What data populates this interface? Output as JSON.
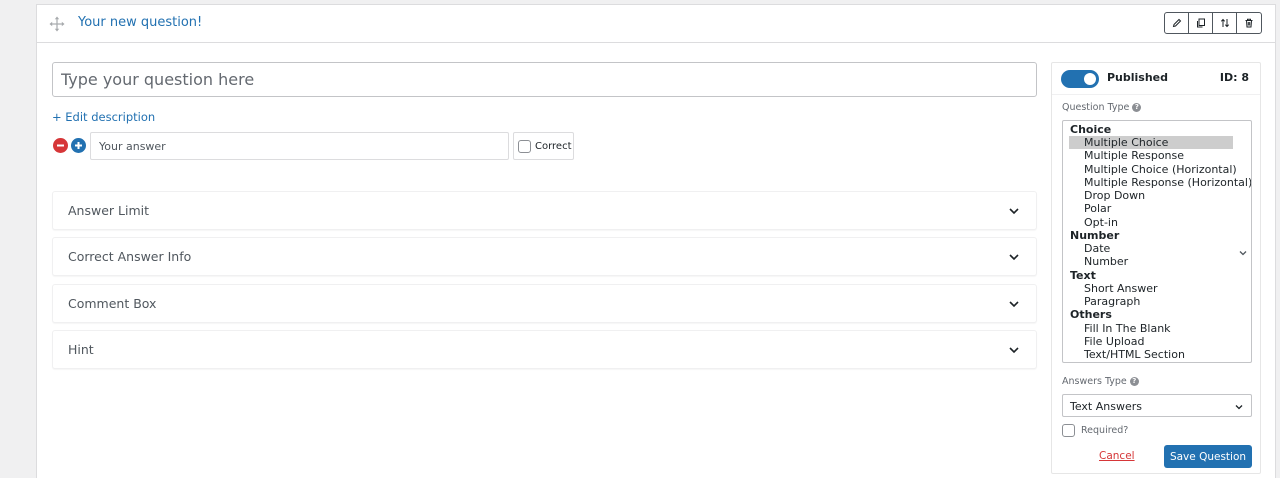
{
  "header": {
    "title": "Your new question!",
    "tools": [
      "pencil-icon",
      "duplicate-icon",
      "sort-arrows-icon",
      "trash-icon"
    ]
  },
  "question": {
    "placeholder": "Type your question here",
    "value": "",
    "edit_description_label": "+ Edit description"
  },
  "answer": {
    "placeholder": "Your answer",
    "value": "",
    "correct_label": "Correct",
    "correct_checked": false
  },
  "accordions": [
    {
      "label": "Answer Limit"
    },
    {
      "label": "Correct Answer Info"
    },
    {
      "label": "Comment Box"
    },
    {
      "label": "Hint"
    }
  ],
  "sidebar": {
    "published_label": "Published",
    "published_on": true,
    "id_label": "ID: 8",
    "question_type_label": "Question Type",
    "question_type_groups": [
      {
        "group": "Choice",
        "options": [
          "Multiple Choice",
          "Multiple Response",
          "Multiple Choice (Horizontal)",
          "Multiple Response (Horizontal)",
          "Drop Down",
          "Polar",
          "Opt-in"
        ]
      },
      {
        "group": "Number",
        "options": [
          "Date",
          "Number"
        ]
      },
      {
        "group": "Text",
        "options": [
          "Short Answer",
          "Paragraph"
        ]
      },
      {
        "group": "Others",
        "options": [
          "Fill In The Blank",
          "File Upload",
          "Text/HTML Section"
        ]
      }
    ],
    "selected_type": "Multiple Choice",
    "answers_type_label": "Answers Type",
    "answers_type_value": "Text Answers",
    "required_label": "Required?",
    "required_checked": false,
    "cancel_label": "Cancel",
    "save_label": "Save Question"
  },
  "colors": {
    "accent": "#2271b1",
    "danger": "#d63638",
    "border": "#dcdcde",
    "selected_option_bg": "#cdcdcd"
  }
}
